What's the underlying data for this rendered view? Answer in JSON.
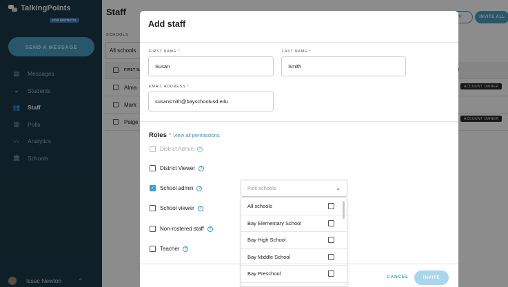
{
  "app": {
    "name": "TalkingPoints",
    "badge": "FOR DISTRICTS",
    "send_button": "SEND A MESSAGE",
    "nav": [
      {
        "label": "Messages",
        "icon": "messages-icon"
      },
      {
        "label": "Students",
        "icon": "students-icon"
      },
      {
        "label": "Staff",
        "icon": "staff-icon",
        "active": true
      },
      {
        "label": "Polls",
        "icon": "polls-icon"
      },
      {
        "label": "Analytics",
        "icon": "analytics-icon"
      },
      {
        "label": "Schools",
        "icon": "schools-icon"
      }
    ],
    "user": {
      "name": "Issac Newton"
    }
  },
  "page": {
    "title": "Staff",
    "schools_label": "SCHOOLS",
    "schools_value": "All schools",
    "table_header": "FIRST NA",
    "rows": [
      "Alma",
      "Mark",
      "Paige"
    ],
    "top_buttons": {
      "partial": "FF",
      "invite_all": "INVITE ALL"
    },
    "badge": "ACCOUNT OWNER",
    "col_hint": "IS"
  },
  "modal": {
    "title": "Add staff",
    "first_name_label": "FIRST NAME",
    "first_name_value": "Susan",
    "last_name_label": "LAST NAME",
    "last_name_value": "Smith",
    "email_label": "EMAIL ADDRESS",
    "email_value": "susansmith@bayschoolusd.edu",
    "required_mark": "*",
    "roles_title": "Roles",
    "view_permissions": "View all permissions",
    "roles": [
      {
        "label": "District Admin",
        "checked": false,
        "disabled": true
      },
      {
        "label": "District Viewer",
        "checked": false
      },
      {
        "label": "School admin",
        "checked": true
      },
      {
        "label": "School viewer",
        "checked": false
      },
      {
        "label": "Non-rostered staff",
        "checked": false
      },
      {
        "label": "Teacher",
        "checked": false
      }
    ],
    "pick_schools_placeholder": "Pick schools",
    "school_options": [
      "All schools",
      "Bay Elementary School",
      "Bay High School",
      "Bay Middle School",
      "Bay Preschool"
    ],
    "cancel": "CANCEL",
    "invite": "INVITE"
  },
  "colors": {
    "sidebar": "#1c3a47",
    "accent": "#4a9fc4",
    "checkbox_checked": "#3a9bd5"
  }
}
